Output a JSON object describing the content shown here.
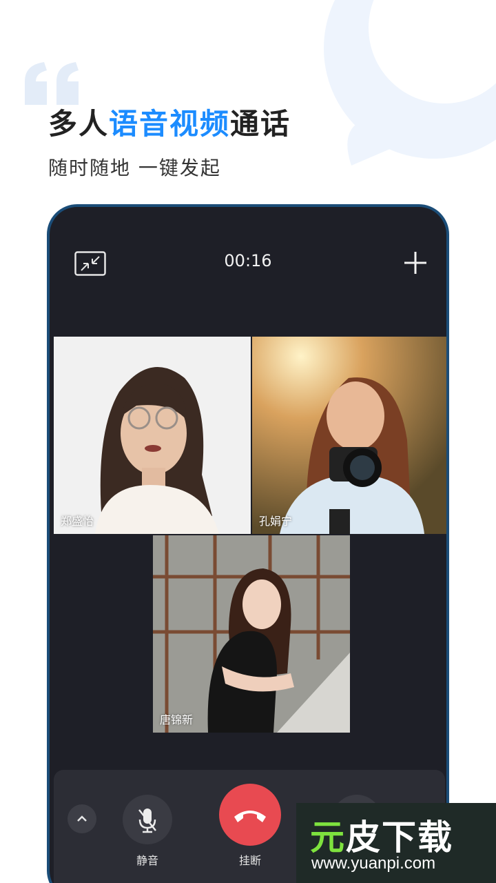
{
  "headline": {
    "part1": "多人",
    "accent": "语音视频",
    "part2": "通话"
  },
  "subline": "随时随地  一键发起",
  "call": {
    "timer": "00:16",
    "participants": [
      {
        "name": "郑盛怡"
      },
      {
        "name": "孔娟宁"
      },
      {
        "name": "唐锦新"
      }
    ]
  },
  "controls": {
    "mute_label": "静音",
    "hangup_label": "挂断"
  },
  "watermark": {
    "title_a": "元",
    "title_b": "皮下载",
    "url": "www.yuanpi.com"
  },
  "colors": {
    "accent": "#1c8cff",
    "hangup": "#e84a51",
    "phone_bg": "#1e1f27"
  },
  "icons": [
    "minimize-icon",
    "plus-icon",
    "chevron-up-icon",
    "mic-off-icon",
    "phone-hangup-icon",
    "quote-icon"
  ]
}
